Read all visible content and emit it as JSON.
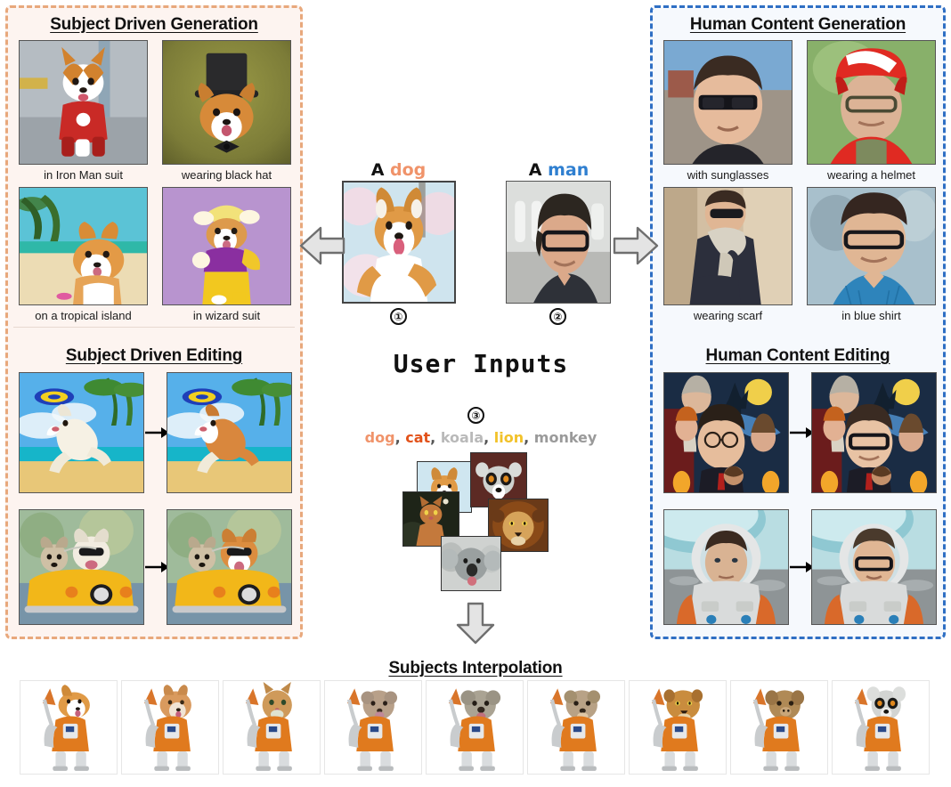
{
  "panels": {
    "left": {
      "sections": [
        {
          "title": "Subject Driven Generation",
          "items": [
            {
              "caption": "in Iron Man suit"
            },
            {
              "caption": "wearing black hat"
            },
            {
              "caption": "on a tropical island"
            },
            {
              "caption": "in wizard suit"
            }
          ]
        },
        {
          "title": "Subject Driven Editing",
          "pairs": [
            {
              "before": "dog-frisbee-beach-white",
              "after": "dog-frisbee-beach-corgi",
              "arrow": "→"
            },
            {
              "before": "dogs-yellow-car-original",
              "after": "dogs-yellow-car-edited",
              "arrow": "→"
            }
          ]
        }
      ]
    },
    "right": {
      "sections": [
        {
          "title": "Human Content Generation",
          "items": [
            {
              "caption": "with sunglasses"
            },
            {
              "caption": "wearing a helmet"
            },
            {
              "caption": "wearing scarf"
            },
            {
              "caption": "in blue shirt"
            }
          ]
        },
        {
          "title": "Human Content Editing",
          "pairs": [
            {
              "before": "harry-potter-poster-original",
              "after": "harry-potter-poster-edited",
              "arrow": "→"
            },
            {
              "before": "astronaut-original",
              "after": "astronaut-edited",
              "arrow": "→"
            }
          ]
        }
      ]
    },
    "bottom": {
      "title": "Subjects Interpolation",
      "frames": [
        {
          "name": "interp-frame-1"
        },
        {
          "name": "interp-frame-2"
        },
        {
          "name": "interp-frame-3"
        },
        {
          "name": "interp-frame-4"
        },
        {
          "name": "interp-frame-5"
        },
        {
          "name": "interp-frame-6"
        },
        {
          "name": "interp-frame-7"
        },
        {
          "name": "interp-frame-8"
        },
        {
          "name": "interp-frame-9"
        }
      ]
    }
  },
  "center": {
    "input1": {
      "prefix": "A ",
      "subject": "dog",
      "number": "①"
    },
    "input2": {
      "prefix": "A ",
      "subject": "man",
      "number": "②"
    },
    "heading": "User Inputs",
    "input3": {
      "number": "③"
    },
    "subjects": [
      {
        "label": "dog",
        "color": "#f0936a"
      },
      {
        "label": "cat",
        "color": "#e2521a"
      },
      {
        "label": "koala",
        "color": "#b9b9b9"
      },
      {
        "label": "lion",
        "color": "#f2c22a"
      },
      {
        "label": "monkey",
        "color": "#9a9a9a"
      }
    ],
    "separator": ", ",
    "arrow_left": "left-block-arrow",
    "arrow_right": "right-block-arrow",
    "arrow_down": "down-block-arrow"
  },
  "colors": {
    "left_border": "#e8a87c",
    "left_bg": "#fdf4f0",
    "right_border": "#2f6fc4",
    "right_bg": "#f6f9fd",
    "bottom_border": "#9a9a9a",
    "accent_dog": "#f0936a",
    "accent_man": "#2f7fd0"
  }
}
